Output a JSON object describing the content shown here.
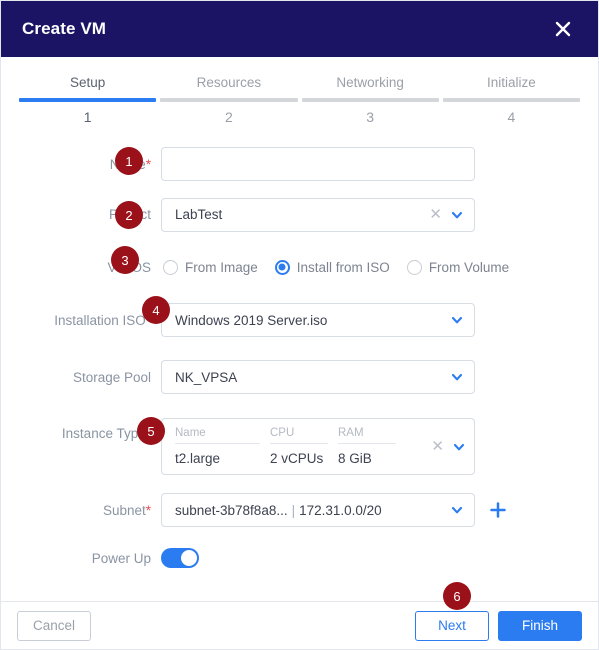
{
  "window": {
    "title": "Create VM",
    "close_icon": "close-icon"
  },
  "stepper": {
    "steps": [
      {
        "label": "Setup",
        "number": "1",
        "active": true
      },
      {
        "label": "Resources",
        "number": "2",
        "active": false
      },
      {
        "label": "Networking",
        "number": "3",
        "active": false
      },
      {
        "label": "Initialize",
        "number": "4",
        "active": false
      }
    ]
  },
  "form": {
    "name": {
      "label": "Name",
      "required": "*",
      "value": "",
      "placeholder": ""
    },
    "project": {
      "label": "Project",
      "value": "LabTest",
      "clear_icon": "clear-x-icon",
      "caret_icon": "chevron-down-icon"
    },
    "vm_os": {
      "label": "VM OS",
      "options": [
        {
          "label": "From Image",
          "selected": false
        },
        {
          "label": "Install from ISO",
          "selected": true
        },
        {
          "label": "From Volume",
          "selected": false
        }
      ]
    },
    "installation_iso": {
      "label": "Installation ISO",
      "required": "*",
      "value": "Windows 2019 Server.iso",
      "caret_icon": "chevron-down-icon"
    },
    "storage_pool": {
      "label": "Storage Pool",
      "value": "NK_VPSA",
      "caret_icon": "chevron-down-icon"
    },
    "instance_type": {
      "label": "Instance Type",
      "required": "*",
      "columns": [
        "Name",
        "CPU",
        "RAM"
      ],
      "row": [
        "t2.large",
        "2 vCPUs",
        "8 GiB"
      ],
      "clear_icon": "clear-x-icon",
      "caret_icon": "chevron-down-icon"
    },
    "subnet": {
      "label": "Subnet",
      "required": "*",
      "value": "subnet-3b78f8a8...",
      "separator": "|",
      "cidr": "172.31.0.0/20",
      "caret_icon": "chevron-down-icon",
      "add_icon": "plus-icon"
    },
    "power_up": {
      "label": "Power Up",
      "enabled": true
    }
  },
  "badges": [
    {
      "number": "1"
    },
    {
      "number": "2"
    },
    {
      "number": "3"
    },
    {
      "number": "4"
    },
    {
      "number": "5"
    },
    {
      "number": "6"
    }
  ],
  "footer": {
    "cancel": "Cancel",
    "next": "Next",
    "finish": "Finish"
  },
  "colors": {
    "header_bg": "#1b1464",
    "accent_blue": "#2b7cf0",
    "badge_red": "#9b1119",
    "required_red": "#f0474b",
    "label_gray": "#8a94a3"
  }
}
